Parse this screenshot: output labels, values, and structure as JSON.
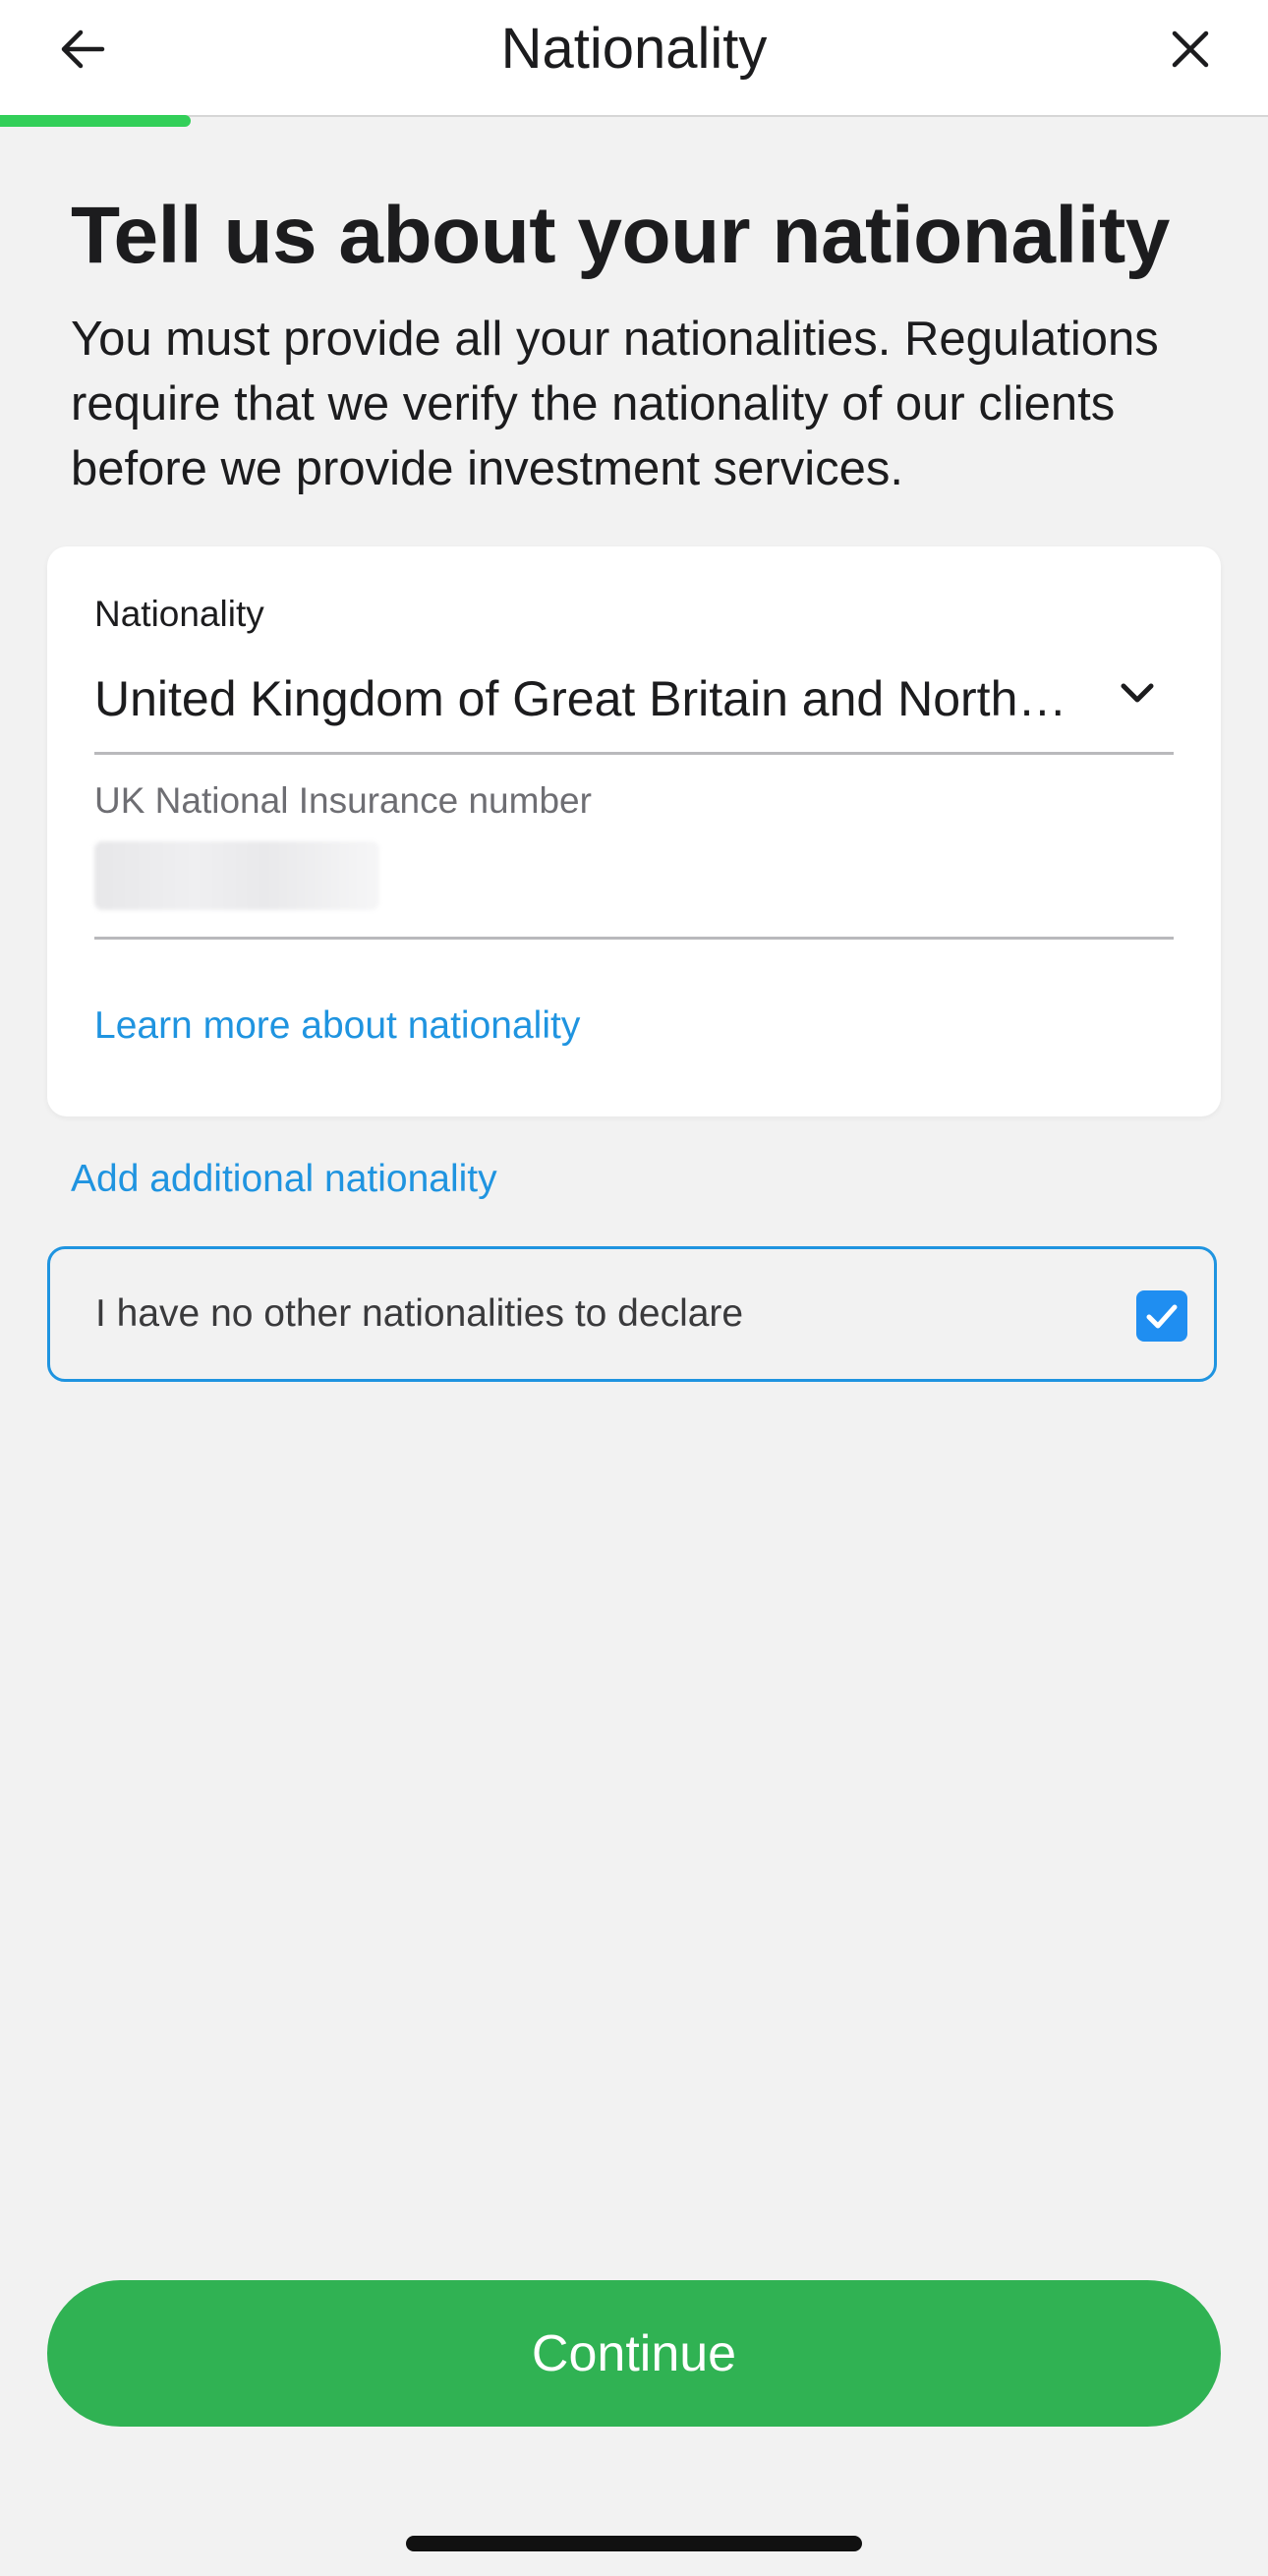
{
  "nav": {
    "title": "Nationality",
    "back_icon": "arrow-left-icon",
    "close_icon": "close-icon"
  },
  "progress": {
    "fraction": 0.15,
    "color": "#33cf59"
  },
  "header": {
    "title": "Tell us about your nationality",
    "description": "You must provide all your nationalities. Regulations require that we verify the nationality of our clients before we provide investment services."
  },
  "nationality_card": {
    "nationality_label": "Nationality",
    "nationality_value": "United Kingdom of Great Britain and Northern Ireland",
    "dropdown_icon": "chevron-down-icon",
    "ni_label": "UK National Insurance number",
    "learn_more_link": "Learn more about nationality"
  },
  "add_nationality_link": "Add additional nationality",
  "declaration": {
    "label": "I have no other nationalities to declare",
    "checked": true
  },
  "continue_button": "Continue",
  "colors": {
    "accent_blue": "#1f94e0",
    "button_green": "#30b253",
    "background": "#f2f2f2"
  }
}
